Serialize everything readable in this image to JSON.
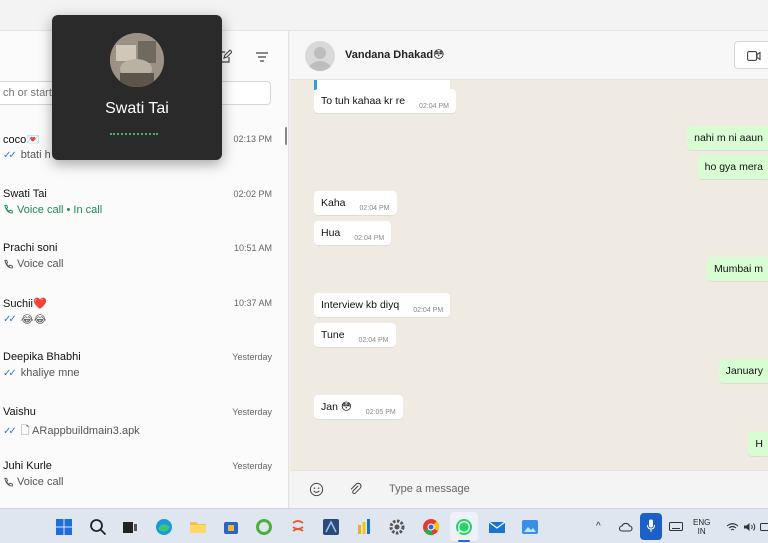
{
  "sidebar": {
    "search_placeholder": "ch or start",
    "chats": [
      {
        "name": "coco💌",
        "time": "02:13 PM",
        "preview": "btati h",
        "prefix": "ticks",
        "active_call": false
      },
      {
        "name": "Swati Tai",
        "time": "02:02 PM",
        "preview": "Voice call • In call",
        "prefix": "phone",
        "active_call": true
      },
      {
        "name": "Prachi soni",
        "time": "10:51 AM",
        "preview": "Voice call",
        "prefix": "phone",
        "active_call": false
      },
      {
        "name": "Suchii❤️",
        "time": "10:37 AM",
        "preview": "😂😂",
        "prefix": "ticks",
        "active_call": false
      },
      {
        "name": "Deepika Bhabhi",
        "time": "Yesterday",
        "preview": "khaliye mne",
        "prefix": "ticks",
        "active_call": false
      },
      {
        "name": "Vaishu",
        "time": "Yesterday",
        "preview": "🗋 ARappbuildmain3.apk",
        "prefix": "ticks",
        "active_call": false
      },
      {
        "name": "Juhi Kurle",
        "time": "Yesterday",
        "preview": "Voice call",
        "prefix": "phone",
        "active_call": false
      }
    ]
  },
  "call_popup": {
    "name": "Swati Tai"
  },
  "chat_header": {
    "name": "Vandana Dhakad😳"
  },
  "messages": [
    {
      "text": "To tuh kahaa kr re",
      "time": "02:04 PM",
      "dir": "in"
    },
    {
      "text": "nahi m ni aaun",
      "time": "",
      "dir": "out"
    },
    {
      "text": "ho gya mera",
      "time": "",
      "dir": "out"
    },
    {
      "text": "Kaha",
      "time": "02:04 PM",
      "dir": "in"
    },
    {
      "text": "Hua",
      "time": "02:04 PM",
      "dir": "in"
    },
    {
      "text": "Mumbai m",
      "time": "",
      "dir": "out"
    },
    {
      "text": "Interview kb diyq",
      "time": "02:04 PM",
      "dir": "in"
    },
    {
      "text": "Tune",
      "time": "02:04 PM",
      "dir": "in"
    },
    {
      "text": "January",
      "time": "",
      "dir": "out"
    },
    {
      "text": "Jan 😳",
      "time": "02:05 PM",
      "dir": "in"
    },
    {
      "text": "H",
      "time": "",
      "dir": "out"
    }
  ],
  "composer": {
    "placeholder": "Type a message"
  },
  "taskbar": {
    "lang_line1": "ENG",
    "lang_line2": "IN"
  },
  "colors": {
    "accent_green": "#1a8a54",
    "tick_blue": "#2f79c6",
    "outgoing_bubble": "#d9fdd3",
    "chat_bg": "#efeae2"
  }
}
